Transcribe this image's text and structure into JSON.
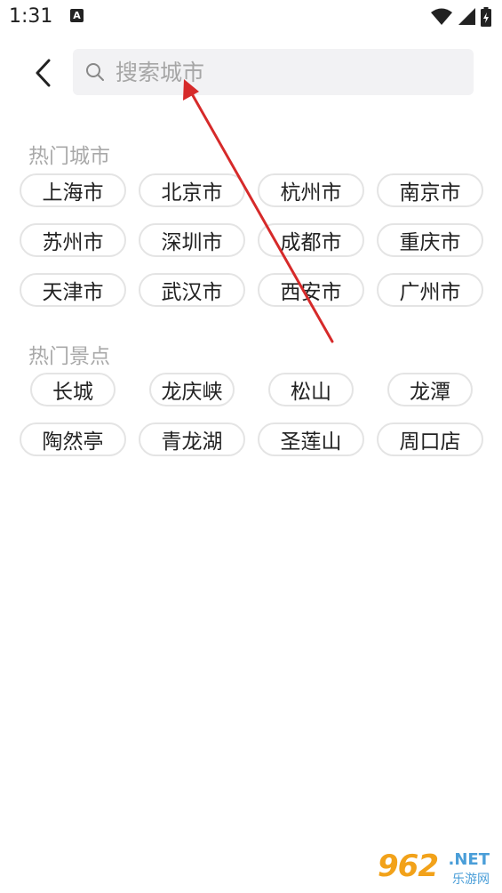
{
  "status_bar": {
    "time": "1:31",
    "notification_letter": "A"
  },
  "search": {
    "placeholder": "搜索城市",
    "value": ""
  },
  "hot_cities": {
    "title": "热门城市",
    "rows": [
      [
        "上海市",
        "北京市",
        "杭州市",
        "南京市"
      ],
      [
        "苏州市",
        "深圳市",
        "成都市",
        "重庆市"
      ],
      [
        "天津市",
        "武汉市",
        "西安市",
        "广州市"
      ]
    ]
  },
  "hot_spots": {
    "title": "热门景点",
    "rows": [
      [
        "长城",
        "龙庆峡",
        "松山",
        "龙潭"
      ],
      [
        "陶然亭",
        "青龙湖",
        "圣莲山",
        "周口店"
      ]
    ]
  },
  "watermark": {
    "number": "962",
    "domain": ".NET",
    "name": "乐游网"
  },
  "colors": {
    "arrow": "#d62a2a",
    "chip_border": "#e4e4e4",
    "section_title": "#a9a9a9",
    "search_bg": "#f2f2f4"
  }
}
